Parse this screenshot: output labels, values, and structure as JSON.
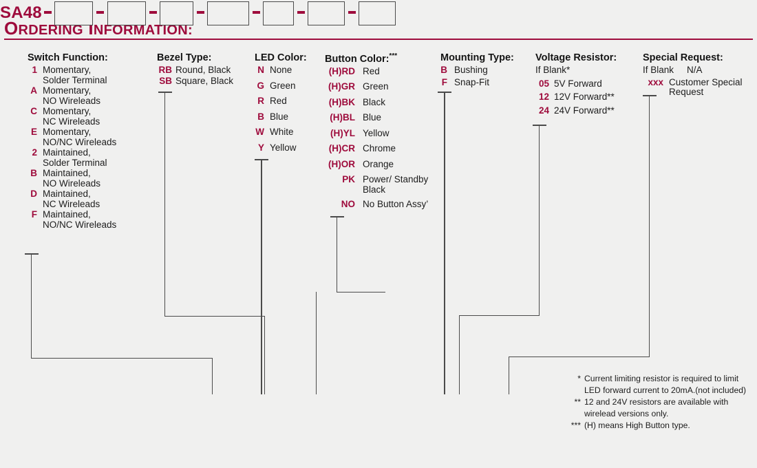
{
  "title": "Ordering Information:",
  "colors": {
    "accent": "#9E0B3C",
    "text": "#1c1c1c",
    "line": "#4a4a4a",
    "background": "#f0f0ef"
  },
  "part_prefix": "SA48",
  "columns": [
    {
      "id": "switch-function",
      "heading": "Switch Function:",
      "items": [
        {
          "code": "1",
          "desc": "Momentary,\nSolder Terminal"
        },
        {
          "code": "A",
          "desc": "Momentary,\nNO Wireleads"
        },
        {
          "code": "C",
          "desc": "Momentary,\nNC Wireleads"
        },
        {
          "code": "E",
          "desc": "Momentary,\nNO/NC Wireleads"
        },
        {
          "code": "2",
          "desc": "Maintained,\nSolder Terminal"
        },
        {
          "code": "B",
          "desc": "Maintained,\nNO Wireleads"
        },
        {
          "code": "D",
          "desc": "Maintained,\nNC Wireleads"
        },
        {
          "code": "F",
          "desc": "Maintained,\nNO/NC Wireleads"
        }
      ]
    },
    {
      "id": "bezel-type",
      "heading": "Bezel Type:",
      "items": [
        {
          "code": "RB",
          "desc": "Round, Black"
        },
        {
          "code": "SB",
          "desc": "Square, Black"
        }
      ]
    },
    {
      "id": "led-color",
      "heading": "LED Color:",
      "items": [
        {
          "code": "N",
          "desc": "None"
        },
        {
          "code": "G",
          "desc": "Green"
        },
        {
          "code": "R",
          "desc": "Red"
        },
        {
          "code": "B",
          "desc": "Blue"
        },
        {
          "code": "W",
          "desc": "White"
        },
        {
          "code": "Y",
          "desc": "Yellow"
        }
      ]
    },
    {
      "id": "button-color",
      "heading": "Button Color:",
      "heading_sup": "***",
      "items": [
        {
          "code": "(H)RD",
          "desc": "Red"
        },
        {
          "code": "(H)GR",
          "desc": "Green"
        },
        {
          "code": "(H)BK",
          "desc": "Black"
        },
        {
          "code": "(H)BL",
          "desc": "Blue"
        },
        {
          "code": "(H)YL",
          "desc": "Yellow"
        },
        {
          "code": "(H)CR",
          "desc": "Chrome"
        },
        {
          "code": "(H)OR",
          "desc": "Orange"
        },
        {
          "code": "PK",
          "desc": "Power/ Standby\nBlack"
        },
        {
          "code": "NO",
          "desc": "No Button Assy’"
        }
      ]
    },
    {
      "id": "mounting-type",
      "heading": "Mounting Type:",
      "items": [
        {
          "code": "B",
          "desc": "Bushing"
        },
        {
          "code": "F",
          "desc": "Snap-Fit"
        }
      ]
    },
    {
      "id": "voltage-resistor",
      "heading": "Voltage Resistor:",
      "items": [
        {
          "code": "If Blank*",
          "desc": "",
          "plain": true
        },
        {
          "code": "05",
          "desc": "5V Forward"
        },
        {
          "code": "12",
          "desc": "12V Forward**"
        },
        {
          "code": "24",
          "desc": "24V Forward**"
        }
      ]
    },
    {
      "id": "special-request",
      "heading": "Special Request:",
      "items": [
        {
          "code": "If Blank",
          "desc": "N/A",
          "plain": true
        },
        {
          "code": "xxx",
          "desc": "Customer Special\nRequest"
        }
      ]
    }
  ],
  "footnotes": [
    {
      "mark": "*",
      "text": "Current limiting resistor is required to limit LED forward current to 20mA.(not included)"
    },
    {
      "mark": "**",
      "text": "12 and 24V resistors are available with wirelead versions only."
    },
    {
      "mark": "***",
      "text": "(H) means High Button type."
    }
  ]
}
